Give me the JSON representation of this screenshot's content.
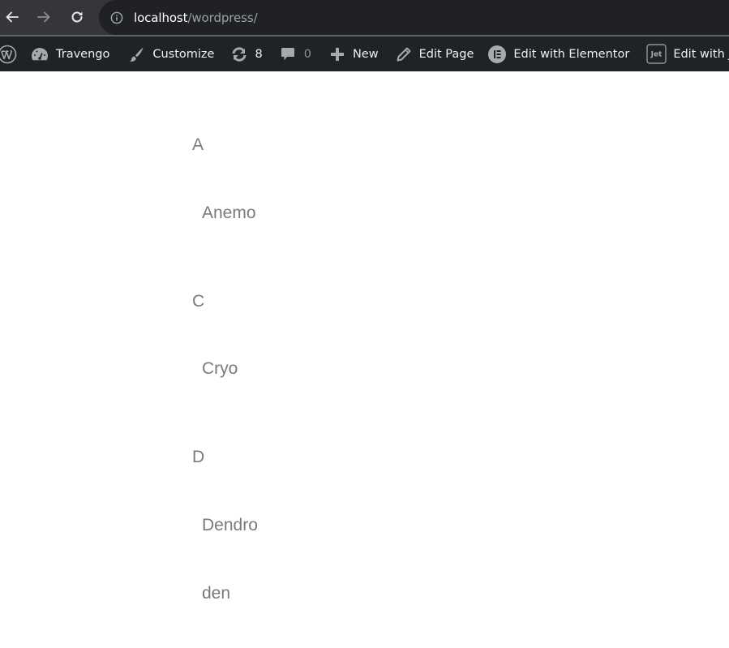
{
  "browser": {
    "url_host": "localhost",
    "url_path": "/wordpress/",
    "back_icon": "arrow-left-icon",
    "forward_icon": "arrow-right-icon",
    "reload_icon": "reload-icon",
    "site_info_icon": "info-circle-icon"
  },
  "admin_bar": {
    "wp_logo_icon": "wordpress-logo-icon",
    "site_name": "Travengo",
    "customize": "Customize",
    "updates_count": "8",
    "comments_count": "0",
    "new": "New",
    "edit_page": "Edit Page",
    "edit_elementor": "Edit with Elementor",
    "edit_jet": "Edit with J",
    "colors": {
      "background": "#1d2327",
      "text": "#f0f0f1",
      "icon": "#a7aaad"
    }
  },
  "glossary": [
    {
      "letter": "A",
      "terms": [
        "Anemo"
      ]
    },
    {
      "letter": "C",
      "terms": [
        "Cryo"
      ]
    },
    {
      "letter": "D",
      "terms": [
        "Dendro",
        "den"
      ]
    }
  ],
  "colors": {
    "content_text": "#7a7a7a",
    "page_background": "#ffffff"
  }
}
